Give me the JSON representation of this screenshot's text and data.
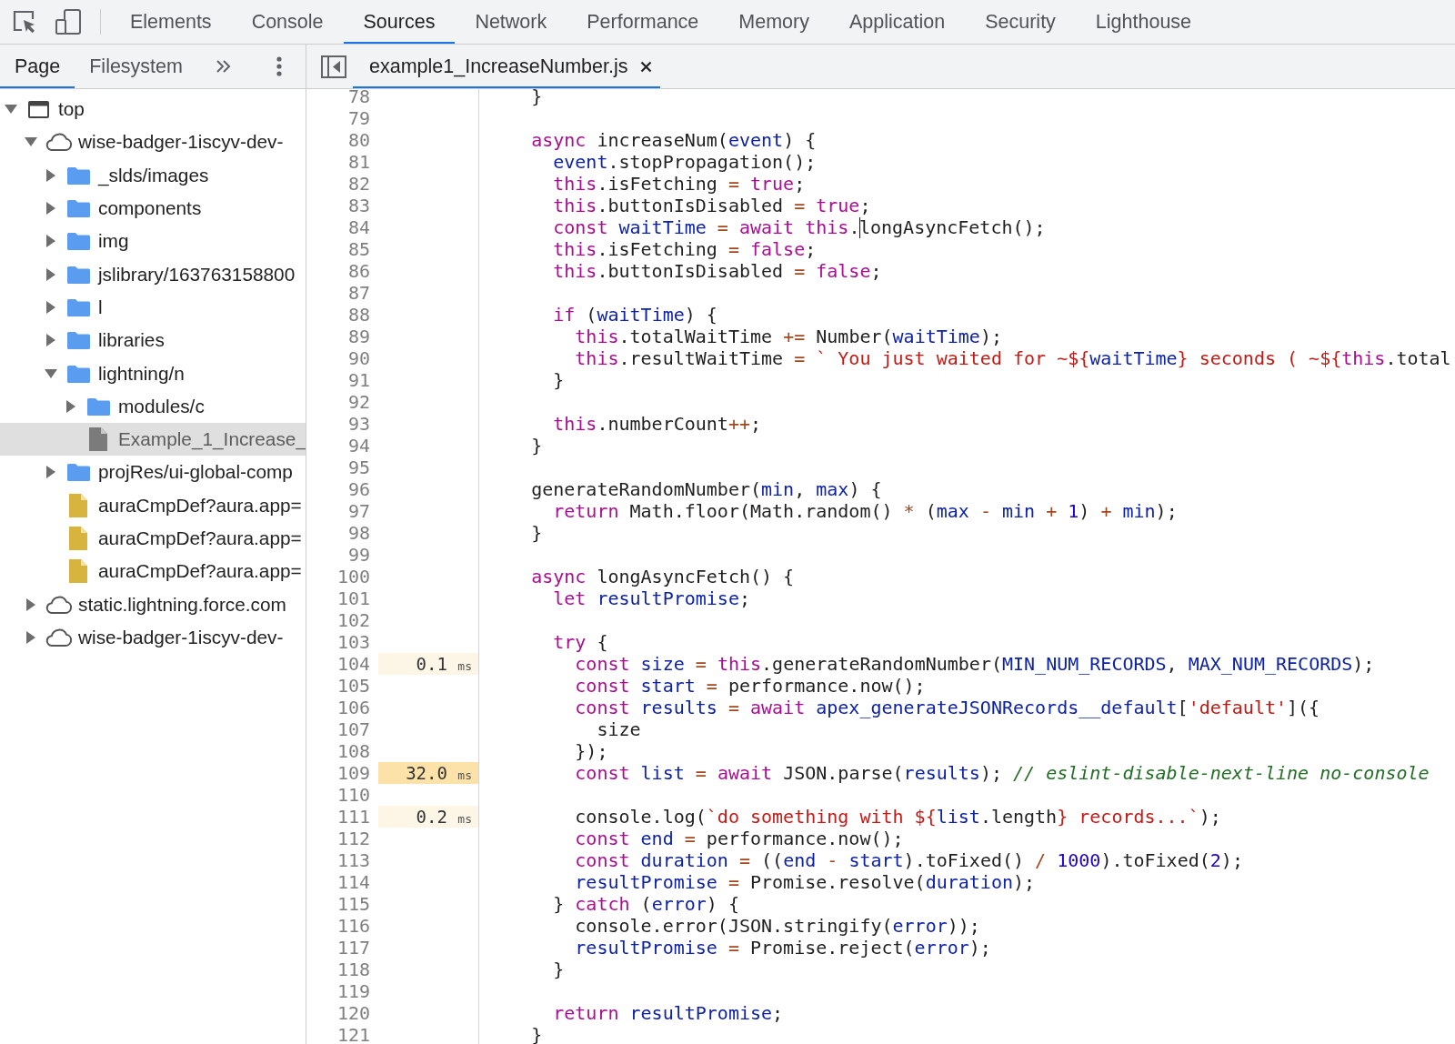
{
  "toolbar": {
    "tabs": [
      {
        "label": "Elements",
        "selected": false
      },
      {
        "label": "Console",
        "selected": false
      },
      {
        "label": "Sources",
        "selected": true
      },
      {
        "label": "Network",
        "selected": false
      },
      {
        "label": "Performance",
        "selected": false
      },
      {
        "label": "Memory",
        "selected": false
      },
      {
        "label": "Application",
        "selected": false
      },
      {
        "label": "Security",
        "selected": false
      },
      {
        "label": "Lighthouse",
        "selected": false
      }
    ]
  },
  "navigator": {
    "tabs": [
      {
        "label": "Page",
        "selected": true
      },
      {
        "label": "Filesystem",
        "selected": false
      }
    ],
    "tree": [
      {
        "label": "top",
        "kind": "frame",
        "expanded": true,
        "selected": false,
        "children": [
          {
            "label": "wise-badger-1iscyv-dev-",
            "kind": "domain",
            "expanded": true,
            "selected": false,
            "children": [
              {
                "label": "_slds/images",
                "kind": "folder",
                "expanded": false,
                "selected": false
              },
              {
                "label": "components",
                "kind": "folder",
                "expanded": false,
                "selected": false
              },
              {
                "label": "img",
                "kind": "folder",
                "expanded": false,
                "selected": false
              },
              {
                "label": "jslibrary/163763158800",
                "kind": "folder",
                "expanded": false,
                "selected": false
              },
              {
                "label": "l",
                "kind": "folder",
                "expanded": false,
                "selected": false
              },
              {
                "label": "libraries",
                "kind": "folder",
                "expanded": false,
                "selected": false
              },
              {
                "label": "lightning/n",
                "kind": "folder",
                "expanded": true,
                "selected": false,
                "children": [
                  {
                    "label": "modules/c",
                    "kind": "folder",
                    "expanded": false,
                    "selected": false
                  },
                  {
                    "label": "Example_1_Increase_",
                    "kind": "file",
                    "selected": true
                  }
                ]
              },
              {
                "label": "projRes/ui-global-comp",
                "kind": "folder",
                "expanded": false,
                "selected": false
              },
              {
                "label": "auraCmpDef?aura.app=",
                "kind": "script",
                "selected": false
              },
              {
                "label": "auraCmpDef?aura.app=",
                "kind": "script",
                "selected": false
              },
              {
                "label": "auraCmpDef?aura.app=",
                "kind": "script",
                "selected": false
              }
            ]
          },
          {
            "label": "static.lightning.force.com",
            "kind": "domain",
            "expanded": false,
            "selected": false
          },
          {
            "label": "wise-badger-1iscyv-dev-",
            "kind": "domain",
            "expanded": false,
            "selected": false
          }
        ]
      }
    ]
  },
  "editor": {
    "tabs": [
      {
        "label": "example1_IncreaseNumber.js",
        "selected": true
      }
    ],
    "lines": [
      {
        "number": "78",
        "segments": [
          {
            "kind": "plain",
            "text": "}"
          }
        ]
      },
      {
        "number": "79"
      },
      {
        "number": "80",
        "segments": [
          {
            "kind": "keyword",
            "text": "async"
          },
          {
            "kind": "plain",
            "text": " increaseNum("
          },
          {
            "kind": "variable",
            "text": "event"
          },
          {
            "kind": "plain",
            "text": ") {"
          }
        ],
        "children": [
          {
            "number": "81",
            "segments": [
              {
                "kind": "variable",
                "text": "event"
              },
              {
                "kind": "plain",
                "text": ".stopPropagation();"
              }
            ]
          },
          {
            "number": "82",
            "segments": [
              {
                "kind": "keyword",
                "text": "this"
              },
              {
                "kind": "plain",
                "text": ".isFetching "
              },
              {
                "kind": "operator",
                "text": "= "
              },
              {
                "kind": "keyword",
                "text": "true"
              },
              {
                "kind": "plain",
                "text": ";"
              }
            ]
          },
          {
            "number": "83",
            "segments": [
              {
                "kind": "keyword",
                "text": "this"
              },
              {
                "kind": "plain",
                "text": ".buttonIsDisabled "
              },
              {
                "kind": "operator",
                "text": "= "
              },
              {
                "kind": "keyword",
                "text": "true"
              },
              {
                "kind": "plain",
                "text": ";"
              }
            ]
          },
          {
            "number": "84",
            "segments": [
              {
                "kind": "keyword",
                "text": "const "
              },
              {
                "kind": "variable",
                "text": "waitTime "
              },
              {
                "kind": "operator",
                "text": "= "
              },
              {
                "kind": "keyword",
                "text": "await this"
              },
              {
                "kind": "plain",
                "text": "."
              },
              {
                "kind": "cursor"
              },
              {
                "kind": "plain",
                "text": "longAsyncFetch();"
              }
            ]
          },
          {
            "number": "85",
            "segments": [
              {
                "kind": "keyword",
                "text": "this"
              },
              {
                "kind": "plain",
                "text": ".isFetching "
              },
              {
                "kind": "operator",
                "text": "= "
              },
              {
                "kind": "keyword",
                "text": "false"
              },
              {
                "kind": "plain",
                "text": ";"
              }
            ]
          },
          {
            "number": "86",
            "segments": [
              {
                "kind": "keyword",
                "text": "this"
              },
              {
                "kind": "plain",
                "text": ".buttonIsDisabled "
              },
              {
                "kind": "operator",
                "text": "= "
              },
              {
                "kind": "keyword",
                "text": "false"
              },
              {
                "kind": "plain",
                "text": ";"
              }
            ]
          },
          {
            "number": "87"
          },
          {
            "number": "88",
            "segments": [
              {
                "kind": "keyword",
                "text": "if"
              },
              {
                "kind": "plain",
                "text": " ("
              },
              {
                "kind": "variable",
                "text": "waitTime"
              },
              {
                "kind": "plain",
                "text": ") {"
              }
            ],
            "children": [
              {
                "number": "89",
                "segments": [
                  {
                    "kind": "keyword",
                    "text": "this"
                  },
                  {
                    "kind": "plain",
                    "text": ".totalWaitTime "
                  },
                  {
                    "kind": "operator",
                    "text": "+="
                  },
                  {
                    "kind": "plain",
                    "text": " Number("
                  },
                  {
                    "kind": "variable",
                    "text": "waitTime"
                  },
                  {
                    "kind": "plain",
                    "text": ");"
                  }
                ]
              },
              {
                "number": "90",
                "segments": [
                  {
                    "kind": "keyword",
                    "text": "this"
                  },
                  {
                    "kind": "plain",
                    "text": ".resultWaitTime "
                  },
                  {
                    "kind": "operator",
                    "text": "= "
                  },
                  {
                    "kind": "string",
                    "text": "` You just waited for ~${"
                  },
                  {
                    "kind": "variable",
                    "text": "waitTime"
                  },
                  {
                    "kind": "string",
                    "text": "} seconds ( ~${"
                  },
                  {
                    "kind": "keyword",
                    "text": "this"
                  },
                  {
                    "kind": "plain",
                    "text": ".total"
                  }
                ]
              }
            ]
          },
          {
            "number": "91",
            "segments": [
              {
                "kind": "plain",
                "text": "}"
              }
            ]
          },
          {
            "number": "92"
          },
          {
            "number": "93",
            "segments": [
              {
                "kind": "keyword",
                "text": "this"
              },
              {
                "kind": "plain",
                "text": ".numberCount"
              },
              {
                "kind": "operator",
                "text": "++"
              },
              {
                "kind": "plain",
                "text": ";"
              }
            ]
          }
        ]
      },
      {
        "number": "94",
        "segments": [
          {
            "kind": "plain",
            "text": "}"
          }
        ]
      },
      {
        "number": "95"
      },
      {
        "number": "96",
        "segments": [
          {
            "kind": "plain",
            "text": "generateRandomNumber("
          },
          {
            "kind": "variable",
            "text": "min"
          },
          {
            "kind": "plain",
            "text": ", "
          },
          {
            "kind": "variable",
            "text": "max"
          },
          {
            "kind": "plain",
            "text": ") {"
          }
        ],
        "children": [
          {
            "number": "97",
            "segments": [
              {
                "kind": "keyword",
                "text": "return"
              },
              {
                "kind": "plain",
                "text": " Math.floor(Math.random() "
              },
              {
                "kind": "operator",
                "text": "*"
              },
              {
                "kind": "plain",
                "text": " ("
              },
              {
                "kind": "variable",
                "text": "max "
              },
              {
                "kind": "operator",
                "text": "- "
              },
              {
                "kind": "variable",
                "text": "min "
              },
              {
                "kind": "operator",
                "text": "+ "
              },
              {
                "kind": "number",
                "text": "1"
              },
              {
                "kind": "plain",
                "text": ") "
              },
              {
                "kind": "operator",
                "text": "+ "
              },
              {
                "kind": "variable",
                "text": "min"
              },
              {
                "kind": "plain",
                "text": ");"
              }
            ]
          }
        ]
      },
      {
        "number": "98",
        "segments": [
          {
            "kind": "plain",
            "text": "}"
          }
        ]
      },
      {
        "number": "99"
      },
      {
        "number": "100",
        "segments": [
          {
            "kind": "keyword",
            "text": "async"
          },
          {
            "kind": "plain",
            "text": " longAsyncFetch() {"
          }
        ],
        "children": [
          {
            "number": "101",
            "segments": [
              {
                "kind": "keyword",
                "text": "let "
              },
              {
                "kind": "variable",
                "text": "resultPromise"
              },
              {
                "kind": "plain",
                "text": ";"
              }
            ]
          },
          {
            "number": "102"
          },
          {
            "number": "103",
            "segments": [
              {
                "kind": "keyword",
                "text": "try"
              },
              {
                "kind": "plain",
                "text": " {"
              }
            ],
            "children": [
              {
                "number": "104",
                "timing": {
                  "value": "0.1",
                  "unit": "ms",
                  "color": "#fdf5e6"
                },
                "segments": [
                  {
                    "kind": "keyword",
                    "text": "const "
                  },
                  {
                    "kind": "variable",
                    "text": "size "
                  },
                  {
                    "kind": "operator",
                    "text": "= "
                  },
                  {
                    "kind": "keyword",
                    "text": "this"
                  },
                  {
                    "kind": "plain",
                    "text": ".generateRandomNumber("
                  },
                  {
                    "kind": "variable",
                    "text": "MIN_NUM_RECORDS"
                  },
                  {
                    "kind": "plain",
                    "text": ", "
                  },
                  {
                    "kind": "variable",
                    "text": "MAX_NUM_RECORDS"
                  },
                  {
                    "kind": "plain",
                    "text": ");"
                  }
                ]
              },
              {
                "number": "105",
                "segments": [
                  {
                    "kind": "keyword",
                    "text": "const "
                  },
                  {
                    "kind": "variable",
                    "text": "start "
                  },
                  {
                    "kind": "operator",
                    "text": "="
                  },
                  {
                    "kind": "plain",
                    "text": " performance.now();"
                  }
                ]
              },
              {
                "number": "106",
                "segments": [
                  {
                    "kind": "keyword",
                    "text": "const "
                  },
                  {
                    "kind": "variable",
                    "text": "results "
                  },
                  {
                    "kind": "operator",
                    "text": "= "
                  },
                  {
                    "kind": "keyword",
                    "text": "await "
                  },
                  {
                    "kind": "variable",
                    "text": "apex_generateJSONRecords__default"
                  },
                  {
                    "kind": "plain",
                    "text": "["
                  },
                  {
                    "kind": "string",
                    "text": "'default'"
                  },
                  {
                    "kind": "plain",
                    "text": "]({"
                  }
                ],
                "children": [
                  {
                    "number": "107",
                    "segments": [
                      {
                        "kind": "plain",
                        "text": "size"
                      }
                    ]
                  }
                ]
              },
              {
                "number": "108",
                "segments": [
                  {
                    "kind": "plain",
                    "text": "});"
                  }
                ]
              },
              {
                "number": "109",
                "timing": {
                  "value": "32.0",
                  "unit": "ms",
                  "color": "#fce1a9"
                },
                "segments": [
                  {
                    "kind": "keyword",
                    "text": "const "
                  },
                  {
                    "kind": "variable",
                    "text": "list "
                  },
                  {
                    "kind": "operator",
                    "text": "= "
                  },
                  {
                    "kind": "keyword",
                    "text": "await"
                  },
                  {
                    "kind": "plain",
                    "text": " JSON.parse("
                  },
                  {
                    "kind": "variable",
                    "text": "results"
                  },
                  {
                    "kind": "plain",
                    "text": "); "
                  },
                  {
                    "kind": "comment",
                    "text": "// eslint-disable-next-line no-console"
                  }
                ]
              },
              {
                "number": "110"
              },
              {
                "number": "111",
                "timing": {
                  "value": "0.2",
                  "unit": "ms",
                  "color": "#fdf5e6"
                },
                "segments": [
                  {
                    "kind": "plain",
                    "text": "console.log("
                  },
                  {
                    "kind": "string",
                    "text": "`do something with ${"
                  },
                  {
                    "kind": "variable",
                    "text": "list"
                  },
                  {
                    "kind": "plain",
                    "text": ".length"
                  },
                  {
                    "kind": "string",
                    "text": "} records...`"
                  },
                  {
                    "kind": "plain",
                    "text": ");"
                  }
                ]
              },
              {
                "number": "112",
                "segments": [
                  {
                    "kind": "keyword",
                    "text": "const "
                  },
                  {
                    "kind": "variable",
                    "text": "end "
                  },
                  {
                    "kind": "operator",
                    "text": "="
                  },
                  {
                    "kind": "plain",
                    "text": " performance.now();"
                  }
                ]
              },
              {
                "number": "113",
                "segments": [
                  {
                    "kind": "keyword",
                    "text": "const "
                  },
                  {
                    "kind": "variable",
                    "text": "duration "
                  },
                  {
                    "kind": "operator",
                    "text": "="
                  },
                  {
                    "kind": "plain",
                    "text": " (("
                  },
                  {
                    "kind": "variable",
                    "text": "end "
                  },
                  {
                    "kind": "operator",
                    "text": "- "
                  },
                  {
                    "kind": "variable",
                    "text": "start"
                  },
                  {
                    "kind": "plain",
                    "text": ").toFixed() "
                  },
                  {
                    "kind": "operator",
                    "text": "/ "
                  },
                  {
                    "kind": "number",
                    "text": "1000"
                  },
                  {
                    "kind": "plain",
                    "text": ").toFixed("
                  },
                  {
                    "kind": "number",
                    "text": "2"
                  },
                  {
                    "kind": "plain",
                    "text": ");"
                  }
                ]
              },
              {
                "number": "114",
                "segments": [
                  {
                    "kind": "variable",
                    "text": "resultPromise "
                  },
                  {
                    "kind": "operator",
                    "text": "="
                  },
                  {
                    "kind": "plain",
                    "text": " Promise.resolve("
                  },
                  {
                    "kind": "variable",
                    "text": "duration"
                  },
                  {
                    "kind": "plain",
                    "text": ");"
                  }
                ]
              }
            ]
          },
          {
            "number": "115",
            "segments": [
              {
                "kind": "plain",
                "text": "} "
              },
              {
                "kind": "keyword",
                "text": "catch"
              },
              {
                "kind": "plain",
                "text": " ("
              },
              {
                "kind": "variable",
                "text": "error"
              },
              {
                "kind": "plain",
                "text": ") {"
              }
            ],
            "children": [
              {
                "number": "116",
                "segments": [
                  {
                    "kind": "plain",
                    "text": "console.error(JSON.stringify("
                  },
                  {
                    "kind": "variable",
                    "text": "error"
                  },
                  {
                    "kind": "plain",
                    "text": "));"
                  }
                ]
              },
              {
                "number": "117",
                "segments": [
                  {
                    "kind": "variable",
                    "text": "resultPromise "
                  },
                  {
                    "kind": "operator",
                    "text": "="
                  },
                  {
                    "kind": "plain",
                    "text": " Promise.reject("
                  },
                  {
                    "kind": "variable",
                    "text": "error"
                  },
                  {
                    "kind": "plain",
                    "text": ");"
                  }
                ]
              }
            ]
          },
          {
            "number": "118",
            "segments": [
              {
                "kind": "plain",
                "text": "}"
              }
            ]
          },
          {
            "number": "119"
          },
          {
            "number": "120",
            "segments": [
              {
                "kind": "keyword",
                "text": "return "
              },
              {
                "kind": "variable",
                "text": "resultPromise"
              },
              {
                "kind": "plain",
                "text": ";"
              }
            ]
          }
        ]
      },
      {
        "number": "121",
        "segments": [
          {
            "kind": "plain",
            "text": "}"
          }
        ]
      }
    ]
  }
}
